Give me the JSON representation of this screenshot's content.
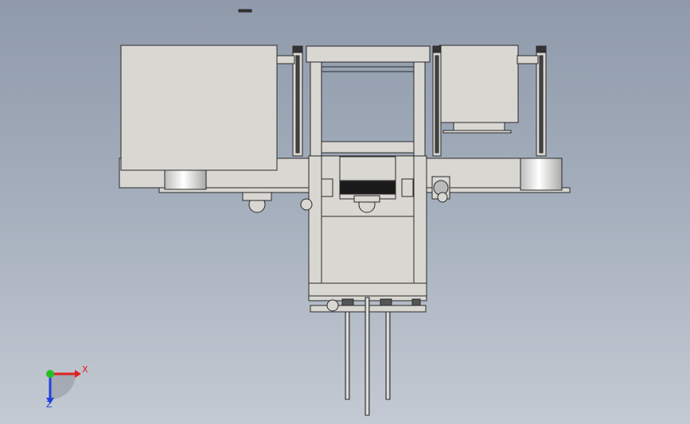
{
  "triad": {
    "x_label": "X",
    "z_label": "Z",
    "colors": {
      "x": "#e02020",
      "y": "#20c020",
      "z": "#2040e0"
    }
  },
  "model": {
    "base_color": "#d9d7d2",
    "edge_color": "#2a2a2a",
    "dark_part_color": "#1a1a1a",
    "cylinder_color": "#e8e8e6"
  }
}
